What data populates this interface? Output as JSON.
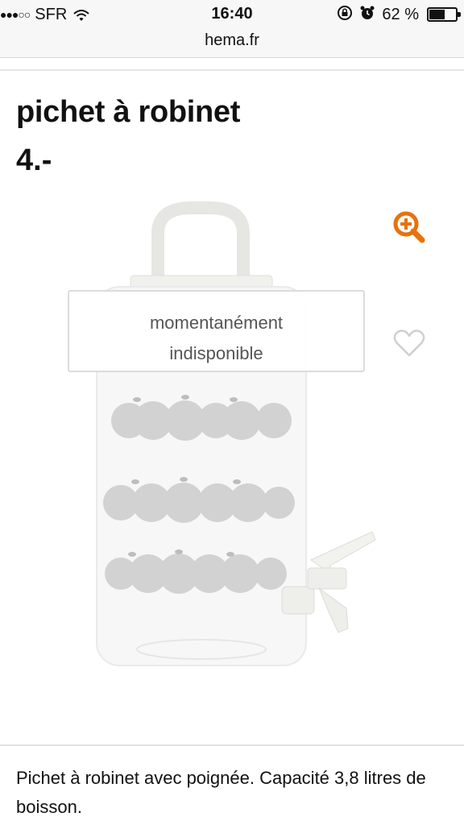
{
  "status_bar": {
    "signal": "●●●○○",
    "carrier": "SFR",
    "time": "16:40",
    "battery_percent": "62 %",
    "battery_level": 0.62,
    "icons": [
      "wifi-icon",
      "orientation-lock-icon",
      "alarm-icon",
      "battery-icon"
    ]
  },
  "browser": {
    "url": "hema.fr"
  },
  "product": {
    "title": "pichet à robinet",
    "price": "4.-",
    "availability": "momentanément indisponible",
    "availability_line1": "momentanément",
    "availability_line2": "indisponible",
    "description": "Pichet à robinet avec poignée. Capacité 3,8 litres de boisson."
  },
  "icons": {
    "zoom": "zoom-in-icon",
    "favorite": "heart-icon"
  },
  "colors": {
    "accent": "#e8720c",
    "heart": "#cfcfcf",
    "statusbar_bg": "#f7f7f7"
  }
}
